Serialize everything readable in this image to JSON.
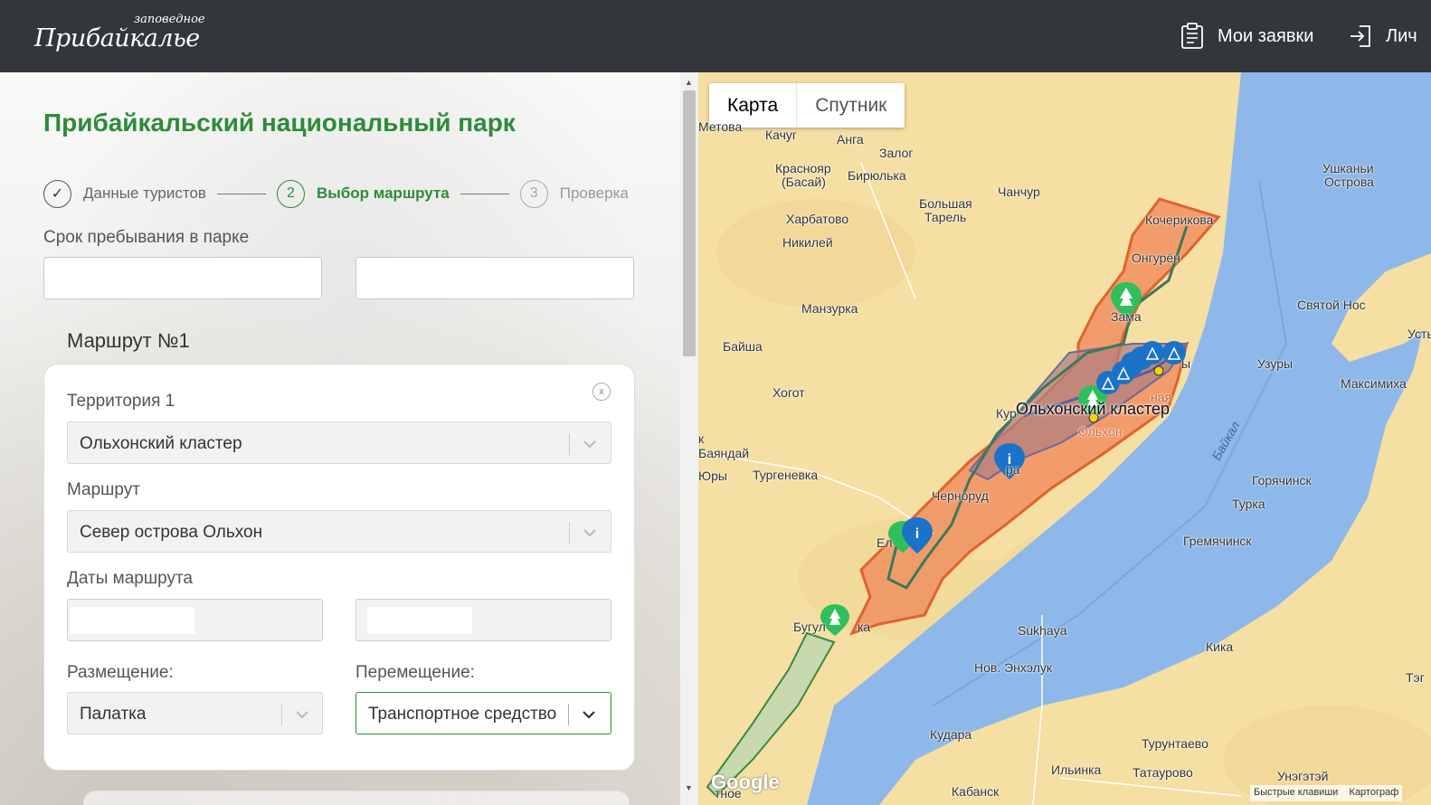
{
  "header": {
    "logo_top": "заповедное",
    "logo_main": "Прибайкалье",
    "nav_requests": "Мои заявки",
    "nav_account": "Лич"
  },
  "form": {
    "park_title": "Прибайкальский национальный парк",
    "steps": [
      {
        "num": "✓",
        "label": "Данные туристов",
        "state": "done"
      },
      {
        "num": "2",
        "label": "Выбор маршрута",
        "state": "active"
      },
      {
        "num": "3",
        "label": "Проверка",
        "state": "future"
      }
    ],
    "stay_label": "Срок пребывания в парке",
    "route_title": "Маршрут №1",
    "close_label": "x",
    "territory_label": "Территория 1",
    "territory_value": "Ольхонский кластер",
    "route_label": "Маршрут",
    "route_value": "Север острова Ольхон",
    "dates_label": "Даты маршрута",
    "accommodation_label": "Размещение:",
    "accommodation_value": "Палатка",
    "movement_label": "Перемещение:",
    "movement_value": "Транспортное средство"
  },
  "map": {
    "tab_map": "Карта",
    "tab_satellite": "Спутник",
    "cluster_label": "Ольхонский кластер",
    "google": "Google",
    "footer_keys": "Быстрые клавиши",
    "footer_data": "Картограф",
    "places": {
      "p1": "Метова",
      "p2": "Качуг",
      "p3": "Анга",
      "p4": "Залог",
      "p5a": "Краснояр",
      "p5b": "(Басай)",
      "p6": "Бирюлька",
      "p7": "Чанчур",
      "p8a": "Ушканьи",
      "p8b": "Острова",
      "p9a": "Большая",
      "p9b": "Тарель",
      "p10": "Харбатово",
      "p11": "Кочерикова",
      "p12": "Никилей",
      "p13": "Онгурён",
      "p14": "Манзурка",
      "p15": "Зама",
      "p16": "Святой Нос",
      "p17": "Байша",
      "p18": "Усть",
      "p19": "Узуры",
      "p20": "Максимиха",
      "p21": "Хогот",
      "p22": "Кур",
      "p23": "Ольхон",
      "p24": "Баяндай",
      "p25": "Байкал",
      "p26": "Юры",
      "p27": "Тургеневка",
      "p28": "Горячинск",
      "p29": "Черноруд",
      "p30": "Турка",
      "p31": "Гремячинск",
      "p32": "Ел",
      "p33": "Бугул",
      "p34": "ка",
      "p35": "Sukhaya",
      "p36": "Кика",
      "p37": "Нов. Энхэлук",
      "p38": "Тэг",
      "p39": "Кудара",
      "p40": "Турунтаево",
      "p41": "Ильинка",
      "p42": "Татаурово",
      "p43": "Унэгэтэй",
      "p44": "Кабанск",
      "p45": "тное",
      "p46": "к",
      "p47": "ы",
      "p48": "ная",
      "p49": "ра"
    }
  }
}
